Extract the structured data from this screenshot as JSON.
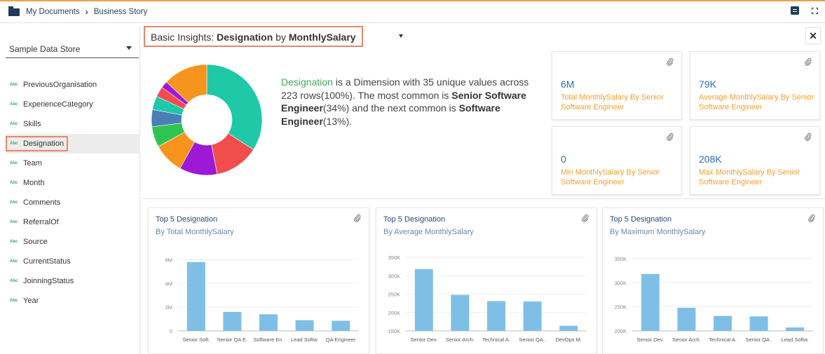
{
  "breadcrumb": {
    "root": "My Documents",
    "current": "Business Story"
  },
  "sidebar": {
    "datastore": "Sample Data Store",
    "fields": [
      {
        "type": "Abc",
        "label": "PreviousOrganisation"
      },
      {
        "type": "Abc",
        "label": "ExperienceCategory"
      },
      {
        "type": "Abc",
        "label": "Skills"
      },
      {
        "type": "Abc",
        "label": "Designation",
        "active": true
      },
      {
        "type": "Abc",
        "label": "Team"
      },
      {
        "type": "Abc",
        "label": "Month"
      },
      {
        "type": "Abc",
        "label": "Comments"
      },
      {
        "type": "Abc",
        "label": "ReferralOf"
      },
      {
        "type": "Abc",
        "label": "Source"
      },
      {
        "type": "Abc",
        "label": "CurrentStatus"
      },
      {
        "type": "Abc",
        "label": "JoinningStatus"
      },
      {
        "type": "Abc",
        "label": "Year"
      }
    ]
  },
  "insight": {
    "prefix": "Basic Insights:",
    "dimension": "Designation",
    "by": "by",
    "measure": "MonthlySalary",
    "close": "✕"
  },
  "summary": {
    "dim": "Designation",
    "text1": " is a Dimension with 35 unique values across 223 rows(100%). The most common is ",
    "common1": "Senior Software Engineer",
    "text2": "(34%) and the next common is ",
    "common2": "Software Engineer",
    "text3": "(13%)."
  },
  "donut": {
    "slices": [
      {
        "value": 34,
        "color": "#1fc9a8"
      },
      {
        "value": 13,
        "color": "#f24d4d"
      },
      {
        "value": 11,
        "color": "#9c1ad6"
      },
      {
        "value": 9,
        "color": "#f7941d"
      },
      {
        "value": 6,
        "color": "#2ec452"
      },
      {
        "value": 5,
        "color": "#4a7fb5"
      },
      {
        "value": 4,
        "color": "#1fc9a8"
      },
      {
        "value": 3,
        "color": "#f24d4d"
      },
      {
        "value": 2,
        "color": "#9c1ad6"
      },
      {
        "value": 13,
        "color": "#f7941d"
      }
    ]
  },
  "kpis": [
    {
      "value": "6M",
      "desc": "Total MonthlySalary By Senior Software Engineer"
    },
    {
      "value": "79K",
      "desc": "Average MonthlySalary By Senior Software Engineer"
    },
    {
      "value": "0",
      "desc": "Min MonthlySalary By Senior Software Engineer"
    },
    {
      "value": "208K",
      "desc": "Max MonthlySalary By Senior Software Engineer"
    }
  ],
  "chart_data": [
    {
      "type": "bar",
      "title": "Top 5 Designation",
      "subtitle": "By Total MonthlySalary",
      "categories": [
        "Senior Soft.",
        "Senior QA E.",
        "Software En.",
        "Lead Softw.",
        "QA Engineer"
      ],
      "values": [
        5800000,
        1600000,
        1400000,
        900000,
        850000
      ],
      "ylim": [
        0,
        6500000
      ],
      "ticks": [
        0,
        2000000,
        4000000,
        6000000
      ],
      "tick_labels": [
        "0",
        "2M",
        "4M",
        "6M"
      ],
      "grid": true,
      "color": "#7fbfe6"
    },
    {
      "type": "bar",
      "title": "Top 5 Designation",
      "subtitle": "By Average MonthlySalary",
      "categories": [
        "Senior Dev.",
        "Senior Arch.",
        "Technical A.",
        "Senior QA .",
        "DevOps M."
      ],
      "values": [
        318000,
        248000,
        231000,
        230000,
        164000
      ],
      "ylim": [
        150000,
        360000
      ],
      "ticks": [
        150000,
        200000,
        250000,
        300000,
        350000
      ],
      "tick_labels": [
        "150K",
        "200K",
        "250K",
        "300K",
        "350K"
      ],
      "grid": true,
      "color": "#7fbfe6"
    },
    {
      "type": "bar",
      "title": "Top 5 Designation",
      "subtitle": "By Maximum MonthlySalary",
      "categories": [
        "Senior Dev.",
        "Senior Arch.",
        "Technical A.",
        "Senior QA .",
        "Lead Softw."
      ],
      "values": [
        318000,
        248000,
        231000,
        230000,
        207000
      ],
      "ylim": [
        200000,
        360000
      ],
      "ticks": [
        200000,
        250000,
        300000,
        350000
      ],
      "tick_labels": [
        "200K",
        "250K",
        "300K",
        "350K"
      ],
      "grid": true,
      "color": "#7fbfe6"
    }
  ]
}
